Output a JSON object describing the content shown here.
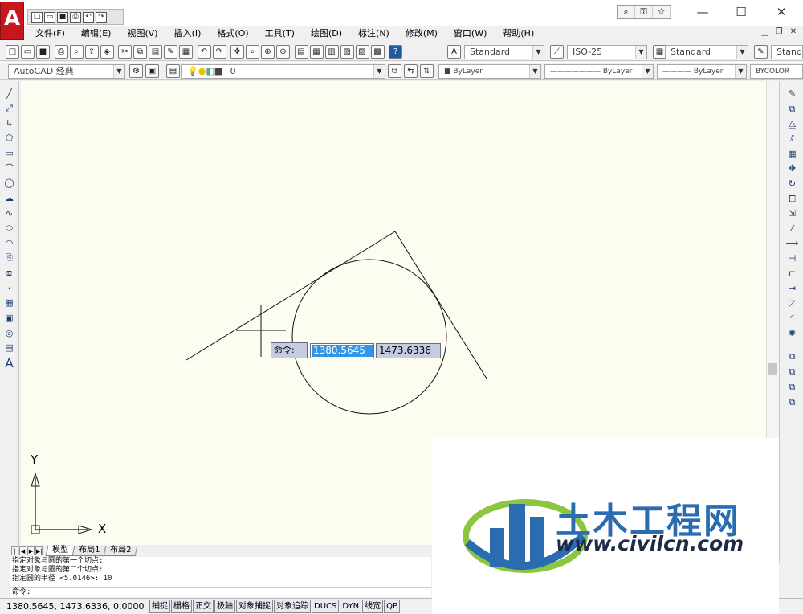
{
  "app": {
    "logo_letter": "A"
  },
  "menu": [
    "文件(F)",
    "编辑(E)",
    "视图(V)",
    "插入(I)",
    "格式(O)",
    "工具(T)",
    "绘图(D)",
    "标注(N)",
    "修改(M)",
    "窗口(W)",
    "帮助(H)"
  ],
  "styles": {
    "text_style": "Standard",
    "dim_style": "ISO-25",
    "table_style": "Standard",
    "multileader_style": "Standa"
  },
  "workspace": "AutoCAD 经典",
  "layer": "0",
  "properties": {
    "color": "ByLayer",
    "linetype": "ByLayer",
    "lineweight": "ByLayer",
    "plot_style": "BYCOLOR"
  },
  "dynamic_input": {
    "label": "命令:",
    "x_value": "1380.5645",
    "y_value": "1473.6336"
  },
  "ucs": {
    "y_label": "Y",
    "x_label": "X"
  },
  "layout_tabs": [
    "模型",
    "布局1",
    "布局2"
  ],
  "command_history": [
    "指定对象与圆的第一个切点:",
    "指定对象与圆的第二个切点:",
    "指定圆的半径 <5.0146>: 10"
  ],
  "command_prompt": "命令:",
  "status": {
    "coords": "1380.5645, 1473.6336, 0.0000",
    "buttons": [
      "捕捉",
      "栅格",
      "正交",
      "极轴",
      "对象捕捉",
      "对象追踪",
      "DUCS",
      "DYN",
      "线宽",
      "QP"
    ]
  },
  "watermark": {
    "title": "土木工程网",
    "url": "www.civilcn.com"
  },
  "colors": {
    "canvas": "#fdfcf0",
    "accent": "#3296e8",
    "brand_red": "#c8161d"
  }
}
